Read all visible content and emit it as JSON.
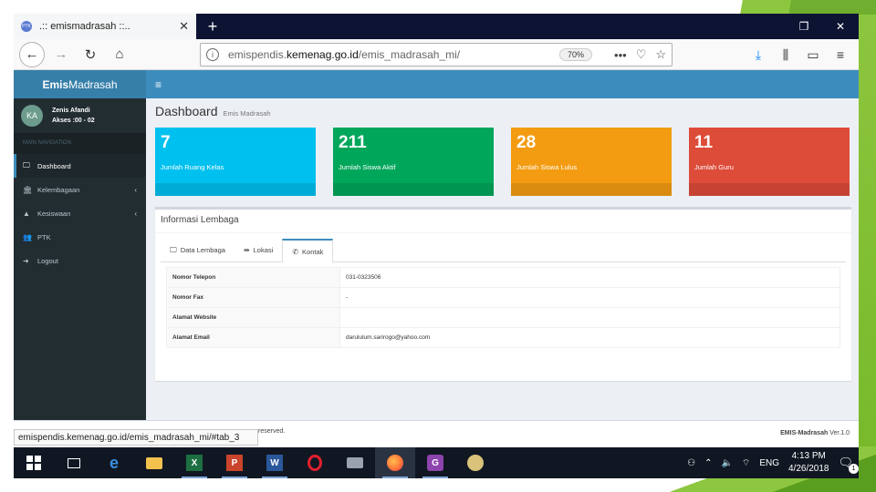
{
  "browser": {
    "tab_title": ".:: emismadrasah ::..",
    "favicon_text": "PTK",
    "new_tab": "+",
    "url_prefix": "emispendis.",
    "url_domain": "kemenag.go.id",
    "url_path": "/emis_madrasah_mi/",
    "zoom": "70%",
    "status_link": "emispendis.kemenag.go.id/emis_madrasah_mi/#tab_3"
  },
  "app": {
    "logo_bold": "Emis",
    "logo_rest": "Madrasah",
    "hamburger": "≡",
    "user": {
      "initials": "KA",
      "name": "Zenis Afandi",
      "access": "Akses :00 - 02"
    },
    "nav_header": "MAIN NAVIGATION",
    "menu": [
      {
        "label": "Dashboard",
        "icon": "desktop-icon"
      },
      {
        "label": "Kelembagaan",
        "icon": "institution-icon"
      },
      {
        "label": "Kesiswaan",
        "icon": "person-icon"
      },
      {
        "label": "PTK",
        "icon": "users-icon"
      },
      {
        "label": "Logout",
        "icon": "logout-icon"
      }
    ],
    "page_title": "Dashboard",
    "page_subtitle": "Emis Madrasah",
    "stats": [
      {
        "value": "7",
        "label": "Jumlah Ruang Kelas",
        "color": "#00c0ef"
      },
      {
        "value": "211",
        "label": "Jumlah Siswa Aktif",
        "color": "#00a65a"
      },
      {
        "value": "28",
        "label": "Jumlah Siswa Lulus",
        "color": "#f39c12"
      },
      {
        "value": "11",
        "label": "Jumlah Guru",
        "color": "#dd4b39"
      }
    ],
    "panel_title": "Informasi Lembaga",
    "tabs": [
      {
        "label": "Data Lembaga",
        "icon": "monitor-icon"
      },
      {
        "label": "Lokasi",
        "icon": "map-signs-icon"
      },
      {
        "label": "Kontak",
        "icon": "phone-icon"
      }
    ],
    "contact_rows": [
      {
        "key": "Nomor Telepon",
        "value": "031-0323506"
      },
      {
        "key": "Nomor Fax",
        "value": "-"
      },
      {
        "key": "Alamat Website",
        "value": ""
      },
      {
        "key": "Alamat Email",
        "value": "darululum.sarirogo@yahoo.com"
      }
    ],
    "footer_left": "reserved.",
    "footer_right_bold": "EMIS-Madrasah",
    "footer_right_rest": " Ver.1.0"
  },
  "taskbar": {
    "lang": "ENG",
    "time": "4:13 PM",
    "date": "4/26/2018",
    "notif_count": "1"
  }
}
